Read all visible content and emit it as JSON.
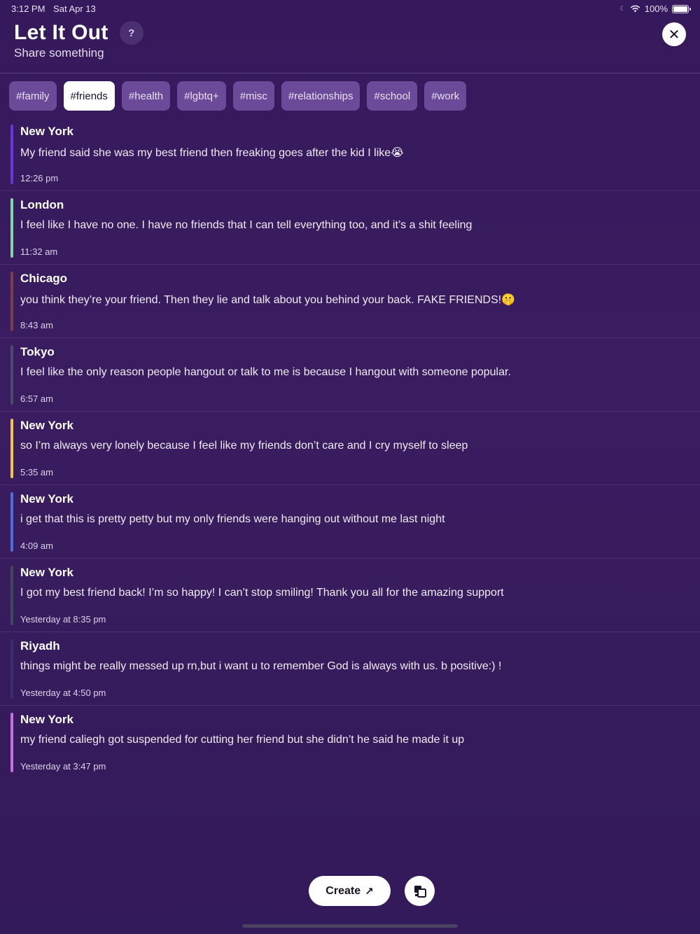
{
  "status_bar": {
    "time": "3:12 PM",
    "date": "Sat Apr 13",
    "battery": "100%"
  },
  "header": {
    "title": "Let It Out",
    "subtitle": "Share something",
    "help_label": "?",
    "close_label": "✕"
  },
  "tags": [
    "#family",
    "#friends",
    "#health",
    "#lgbtq+",
    "#misc",
    "#relationships",
    "#school",
    "#work"
  ],
  "active_tag": "#friends",
  "posts": [
    {
      "location": "New York",
      "text": "My friend said she was my best friend then freaking goes after the kid I like😭",
      "time": "12:26 pm",
      "accent": "#6a35d8"
    },
    {
      "location": "London",
      "text": "I feel like I have no one. I have no friends that I can tell everything too, and it’s a shit feeling",
      "time": "11:32 am",
      "accent": "#7ed6a4"
    },
    {
      "location": "Chicago",
      "text": "you think they’re your friend. Then they lie and talk about you behind your back. FAKE FRIENDS!🤫",
      "time": "8:43 am",
      "accent": "#7a3f4a"
    },
    {
      "location": "Tokyo",
      "text": "I feel like the only reason people hangout or talk to me is because I hangout with someone popular.",
      "time": "6:57 am",
      "accent": "#4a4a6a"
    },
    {
      "location": "New York",
      "text": "so I’m always very lonely because I feel like my friends don’t care and I cry myself to sleep",
      "time": "5:35 am",
      "accent": "#f2c241"
    },
    {
      "location": "New York",
      "text": "i get that this is pretty petty but my only friends were hanging out without me last night",
      "time": "4:09 am",
      "accent": "#4a6ee0"
    },
    {
      "location": "New York",
      "text": "I got my best friend back! I’m so happy! I can’t stop smiling! Thank you all for the amazing support",
      "time": "Yesterday at 8:35 pm",
      "accent": "#3e4a5a"
    },
    {
      "location": "Riyadh",
      "text": "things might be really messed up rn,but i want u to remember God is always with us. b positive:) !",
      "time": "Yesterday at 4:50 pm",
      "accent": "#3a2e6e"
    },
    {
      "location": "New York",
      "text": "my friend caliegh got suspended for cutting her friend but she didn’t he said he made it up",
      "time": "Yesterday at 3:47 pm",
      "accent": "#c26fe6"
    }
  ],
  "bottom": {
    "create_label": "Create",
    "create_icon": "arrow-up-icon",
    "share_icon": "stickers-icon"
  }
}
